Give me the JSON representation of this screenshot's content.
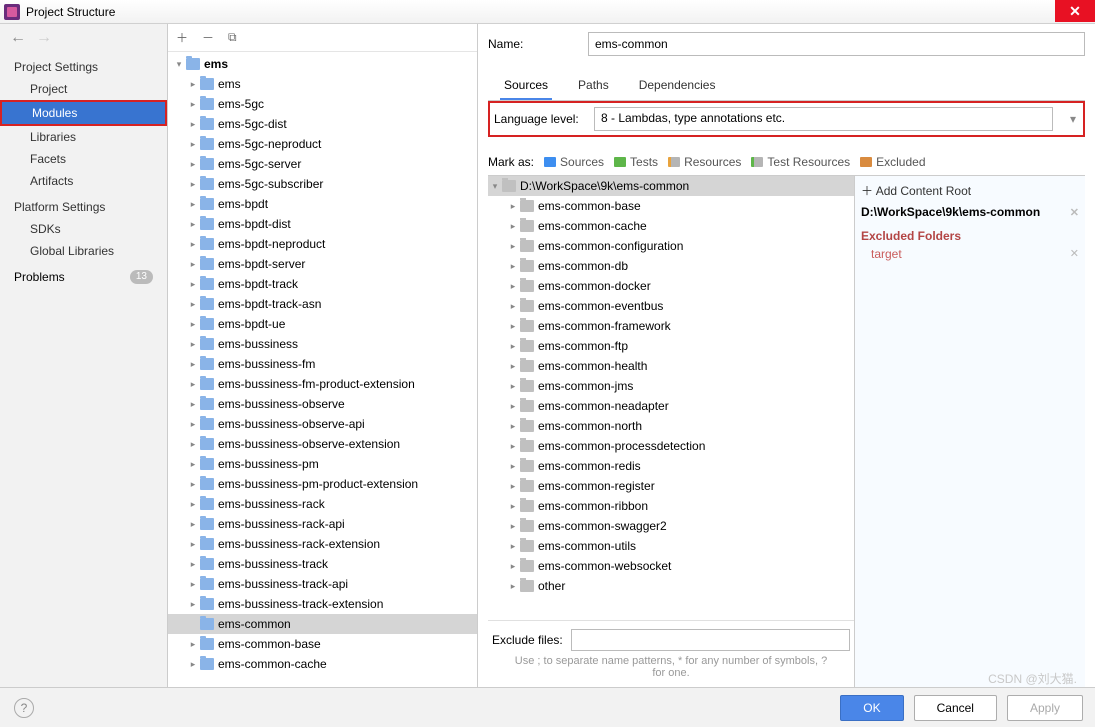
{
  "window": {
    "title": "Project Structure"
  },
  "nav": {
    "project_settings": {
      "title": "Project Settings",
      "items": [
        "Project",
        "Modules",
        "Libraries",
        "Facets",
        "Artifacts"
      ],
      "selected_index": 1
    },
    "platform_settings": {
      "title": "Platform Settings",
      "items": [
        "SDKs",
        "Global Libraries"
      ]
    },
    "problems": {
      "label": "Problems",
      "count": "13"
    }
  },
  "modules_tree": {
    "root": "ems",
    "selected": "ems-common",
    "items": [
      "ems",
      "ems-5gc",
      "ems-5gc-dist",
      "ems-5gc-neproduct",
      "ems-5gc-server",
      "ems-5gc-subscriber",
      "ems-bpdt",
      "ems-bpdt-dist",
      "ems-bpdt-neproduct",
      "ems-bpdt-server",
      "ems-bpdt-track",
      "ems-bpdt-track-asn",
      "ems-bpdt-ue",
      "ems-bussiness",
      "ems-bussiness-fm",
      "ems-bussiness-fm-product-extension",
      "ems-bussiness-observe",
      "ems-bussiness-observe-api",
      "ems-bussiness-observe-extension",
      "ems-bussiness-pm",
      "ems-bussiness-pm-product-extension",
      "ems-bussiness-rack",
      "ems-bussiness-rack-api",
      "ems-bussiness-rack-extension",
      "ems-bussiness-track",
      "ems-bussiness-track-api",
      "ems-bussiness-track-extension",
      "ems-common",
      "ems-common-base",
      "ems-common-cache"
    ]
  },
  "details": {
    "name_label": "Name:",
    "name_value": "ems-common",
    "tabs": [
      "Sources",
      "Paths",
      "Dependencies"
    ],
    "active_tab": 0,
    "language_level_label": "Language level:",
    "language_level_value": "8 - Lambdas, type annotations etc.",
    "mark_as_label": "Mark as:",
    "mark_as": [
      "Sources",
      "Tests",
      "Resources",
      "Test Resources",
      "Excluded"
    ],
    "source_root": "D:\\WorkSpace\\9k\\ems-common",
    "source_children": [
      "ems-common-base",
      "ems-common-cache",
      "ems-common-configuration",
      "ems-common-db",
      "ems-common-docker",
      "ems-common-eventbus",
      "ems-common-framework",
      "ems-common-ftp",
      "ems-common-health",
      "ems-common-jms",
      "ems-common-neadapter",
      "ems-common-north",
      "ems-common-processdetection",
      "ems-common-redis",
      "ems-common-register",
      "ems-common-ribbon",
      "ems-common-swagger2",
      "ems-common-utils",
      "ems-common-websocket",
      "other"
    ],
    "exclude_label": "Exclude files:",
    "exclude_value": "",
    "exclude_help": "Use ; to separate name patterns, * for any number of symbols, ? for one.",
    "content_roots": {
      "add_label": "Add Content Root",
      "path": "D:\\WorkSpace\\9k\\ems-common",
      "excluded_title": "Excluded Folders",
      "excluded": [
        "target"
      ]
    }
  },
  "footer": {
    "ok": "OK",
    "cancel": "Cancel",
    "apply": "Apply"
  },
  "watermark": "CSDN @刘大猫."
}
